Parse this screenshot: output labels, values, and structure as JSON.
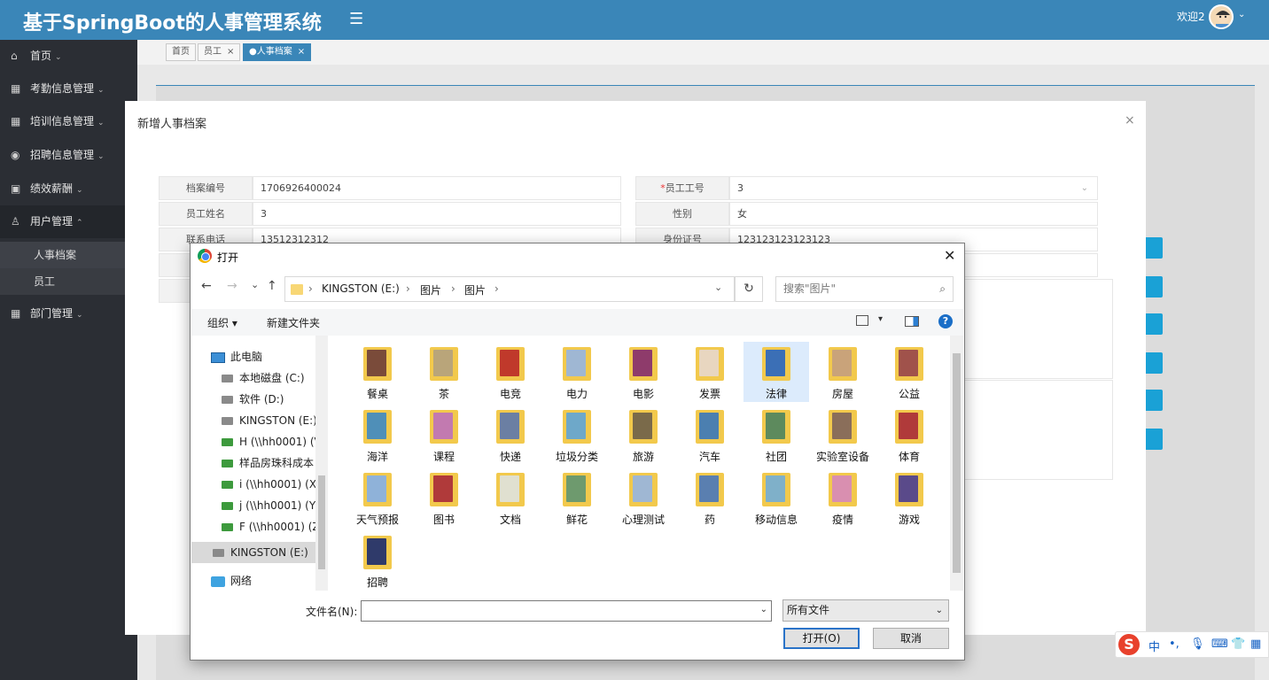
{
  "header": {
    "title": "基于SpringBoot的人事管理系统",
    "welcome": "欢迎2",
    "accent": "#3a86b8"
  },
  "sidebar": {
    "items": [
      {
        "label": "首页",
        "icon": "home-icon"
      },
      {
        "label": "考勤信息管理",
        "icon": "grid-icon"
      },
      {
        "label": "培训信息管理",
        "icon": "grid-icon"
      },
      {
        "label": "招聘信息管理",
        "icon": "compass-icon"
      },
      {
        "label": "绩效薪酬",
        "icon": "id-card-icon"
      },
      {
        "label": "用户管理",
        "icon": "user-icon"
      },
      {
        "label": "部门管理",
        "icon": "grid-icon"
      }
    ],
    "subitems": [
      "人事档案",
      "员工"
    ]
  },
  "tabs": [
    {
      "label": "首页"
    },
    {
      "label": "员工",
      "close": "×"
    },
    {
      "label": "●人事档案",
      "close": "×"
    }
  ],
  "modal": {
    "title": "新增人事档案",
    "close": "×",
    "fields": {
      "archive_no_label": "档案编号",
      "archive_no_value": "1706926400024",
      "emp_no_label": "员工工号",
      "emp_no_value": "3",
      "emp_name_label": "员工姓名",
      "emp_name_value": "3",
      "gender_label": "性别",
      "gender_value": "女",
      "phone_label": "联系电话",
      "phone_value": "13512312312",
      "idcard_label": "身份证号",
      "idcard_value": "123123123123123",
      "req_mark": "*",
      "partial_label": "入"
    }
  },
  "file_dialog": {
    "title": "打开",
    "close": "✕",
    "nav": {
      "back": "←",
      "forward": "→",
      "recent": "⌄",
      "up": "↑"
    },
    "breadcrumb": [
      "KINGSTON (E:)",
      "图片",
      "图片"
    ],
    "crumb_sep": "›",
    "refresh": "↻",
    "search_placeholder": "搜索\"图片\"",
    "toolbar": {
      "organize": "组织 ▾",
      "new_folder": "新建文件夹",
      "view_dd": "▾",
      "help": "?"
    },
    "tree": [
      {
        "label": "此电脑",
        "kind": "pc"
      },
      {
        "label": "本地磁盘 (C:)",
        "kind": "drive"
      },
      {
        "label": "软件 (D:)",
        "kind": "drive"
      },
      {
        "label": "KINGSTON (E:)",
        "kind": "drive"
      },
      {
        "label": "H (\\\\hh0001) (V",
        "kind": "drive"
      },
      {
        "label": "样品房珠科成本",
        "kind": "drive"
      },
      {
        "label": "i (\\\\hh0001) (X:",
        "kind": "drive"
      },
      {
        "label": "j (\\\\hh0001) (Y:",
        "kind": "drive"
      },
      {
        "label": "F (\\\\hh0001) (Z",
        "kind": "drive"
      },
      {
        "label": "KINGSTON (E:)",
        "kind": "drive",
        "selected": true
      },
      {
        "label": "网络",
        "kind": "network"
      }
    ],
    "folders": [
      "餐桌",
      "茶",
      "电竞",
      "电力",
      "电影",
      "发票",
      "法律",
      "房屋",
      "公益",
      "海洋",
      "课程",
      "快递",
      "垃圾分类",
      "旅游",
      "汽车",
      "社团",
      "实验室设备",
      "体育",
      "天气预报",
      "图书",
      "文档",
      "鲜花",
      "心理测试",
      "药",
      "移动信息",
      "疫情",
      "游戏",
      "招聘"
    ],
    "selected_folder": "法律",
    "filename_label": "文件名(N):",
    "filename_value": "",
    "filetype": "所有文件",
    "open_button": "打开(O)",
    "cancel_button": "取消"
  },
  "ime": {
    "logo": "S",
    "lang": "中",
    "punct": "•,",
    "mic": "🎙",
    "keyboard": "⌨",
    "skin": "👕",
    "grid": "▦"
  }
}
